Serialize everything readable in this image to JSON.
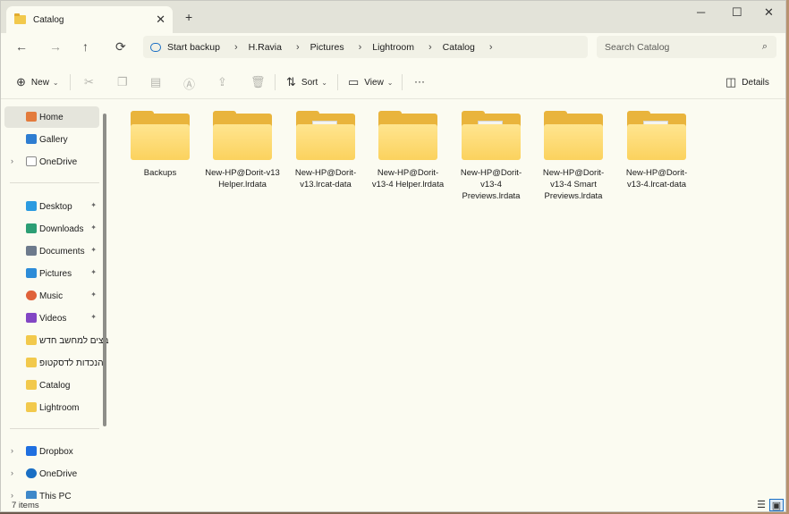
{
  "window": {
    "tab_title": "Catalog",
    "new_tab": "+",
    "minimize": "─",
    "maximize": "☐",
    "close": "✕"
  },
  "nav": {
    "back": "←",
    "forward": "→",
    "up": "↑",
    "refresh": "⟳"
  },
  "address": {
    "crumbs": [
      "Start backup",
      "H.Ravia",
      "Pictures",
      "Lightroom",
      "Catalog"
    ],
    "separator": "›"
  },
  "search": {
    "placeholder": "Search Catalog",
    "icon": "search-icon"
  },
  "toolbar": {
    "new_label": "New",
    "sort_label": "Sort",
    "view_label": "View",
    "more_label": "···",
    "details_label": "Details"
  },
  "sidebar": {
    "items": [
      {
        "label": "Home",
        "icon": "home-icon",
        "color": "#e37b3c",
        "selected": true
      },
      {
        "label": "Gallery",
        "icon": "gallery-icon",
        "color": "#2e7dd1"
      },
      {
        "label": "OneDrive",
        "icon": "document-icon",
        "color": "#8a8a8a",
        "expandable": true
      },
      {
        "label": "Desktop",
        "icon": "desktop-icon",
        "color": "#2c9be0",
        "pinned": true
      },
      {
        "label": "Downloads",
        "icon": "download-icon",
        "color": "#2c9e74",
        "pinned": true
      },
      {
        "label": "Documents",
        "icon": "documents-icon",
        "color": "#6d7a8c",
        "pinned": true
      },
      {
        "label": "Pictures",
        "icon": "pictures-icon",
        "color": "#2d8cd8",
        "pinned": true
      },
      {
        "label": "Music",
        "icon": "music-icon",
        "color": "#e0623a",
        "pinned": true
      },
      {
        "label": "Videos",
        "icon": "videos-icon",
        "color": "#8246c4",
        "pinned": true
      },
      {
        "label": "קבצים למחשב חדש",
        "icon": "folder-icon",
        "color": "#f2c94c"
      },
      {
        "label": "הנכדות לדסקטופ",
        "icon": "folder-icon",
        "color": "#f2c94c"
      },
      {
        "label": "Catalog",
        "icon": "folder-icon",
        "color": "#f2c94c"
      },
      {
        "label": "Lightroom",
        "icon": "folder-icon",
        "color": "#f2c94c"
      },
      {
        "label": "Dropbox",
        "icon": "dropbox-icon",
        "color": "#1f6fe0",
        "expandable": true
      },
      {
        "label": "OneDrive",
        "icon": "onedrive-icon",
        "color": "#1a6fc4",
        "expandable": true
      },
      {
        "label": "This PC",
        "icon": "pc-icon",
        "color": "#3e88c9",
        "expandable": true
      }
    ],
    "pin_glyph": "📌",
    "expand_glyph": "›"
  },
  "files": [
    {
      "name": "Backups",
      "kind": "empty"
    },
    {
      "name": "New-HP@Dorit-v13 Helper.lrdata",
      "kind": "empty"
    },
    {
      "name": "New-HP@Dorit-v13.lrcat-data",
      "kind": "paper"
    },
    {
      "name": "New-HP@Dorit-v13-4 Helper.lrdata",
      "kind": "empty"
    },
    {
      "name": "New-HP@Dorit-v13-4 Previews.lrdata",
      "kind": "paper"
    },
    {
      "name": "New-HP@Dorit-v13-4 Smart Previews.lrdata",
      "kind": "empty"
    },
    {
      "name": "New-HP@Dorit-v13-4.lrcat-data",
      "kind": "paper"
    }
  ],
  "status": {
    "count": "7 items"
  }
}
